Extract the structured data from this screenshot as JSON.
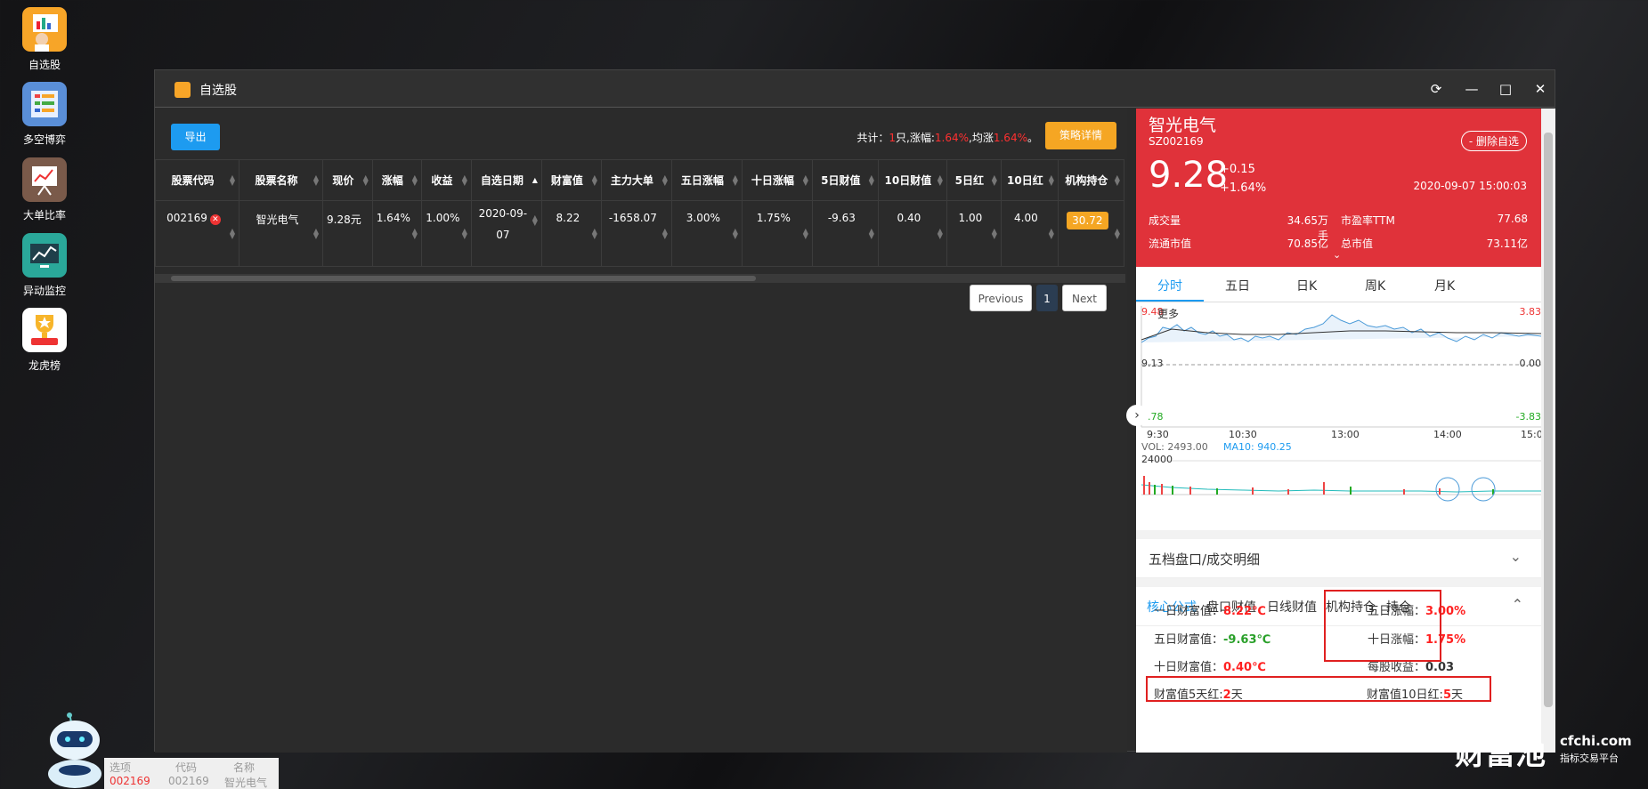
{
  "desktop": {
    "icons": [
      {
        "label": "自选股",
        "icon": "watchlist-icon",
        "color": "#f7a528"
      },
      {
        "label": "多空博弈",
        "icon": "long-short-icon",
        "color": "#5a8fd8"
      },
      {
        "label": "大单比率",
        "icon": "big-order-icon",
        "color": "#7a5a4a"
      },
      {
        "label": "异动监控",
        "icon": "monitor-icon",
        "color": "#2aa89a"
      },
      {
        "label": "龙虎榜",
        "icon": "trophy-icon",
        "color": "#ffffff"
      }
    ]
  },
  "window": {
    "title": "自选股",
    "controls": {
      "refresh": "⟳",
      "minimize": "—",
      "maximize": "□",
      "close": "✕"
    }
  },
  "toolbar": {
    "export_label": "导出",
    "summary": {
      "prefix": "共计：",
      "count": "1",
      "mid1": "只,涨幅:",
      "rise": "1.64%",
      "mid2": ",均涨",
      "avg": "1.64%",
      "suffix": "。"
    },
    "strategy_label": "策略详情"
  },
  "table": {
    "headers": [
      "股票代码",
      "股票名称",
      "现价",
      "涨幅",
      "收益",
      "自选日期",
      "财富值",
      "主力大单",
      "五日涨幅",
      "十日涨幅",
      "5日财值",
      "10日财值",
      "5日红",
      "10日红",
      "机构持仓"
    ],
    "rows": [
      {
        "code": "002169",
        "name": "智光电气",
        "price": "9.28元",
        "change": "1.64%",
        "profit": "1.00%",
        "date_line1": "2020-09-",
        "date_line2": "07",
        "wealth": "8.22",
        "main_big": "-1658.07",
        "five_day_rise": "3.00%",
        "ten_day_rise": "1.75%",
        "five_day_wealth": "-9.63",
        "ten_day_wealth": "0.40",
        "five_day_red": "1.00",
        "ten_day_red": "4.00",
        "institution": "30.72"
      }
    ]
  },
  "pagination": {
    "previous": "Previous",
    "page": "1",
    "next": "Next"
  },
  "quote": {
    "name": "智光电气",
    "code": "SZ002169",
    "remove_label": "- 删除自选",
    "price": "9.28",
    "change": "+0.15",
    "change_pct": "+1.64%",
    "datetime": "2020-09-07 15:00:03",
    "stats": [
      {
        "label": "成交量",
        "value": "34.65万手"
      },
      {
        "label": "市盈率TTM",
        "value": "77.68"
      },
      {
        "label": "流通市值",
        "value": "70.85亿"
      },
      {
        "label": "总市值",
        "value": "73.11亿"
      }
    ]
  },
  "chart_tabs": [
    "分时",
    "五日",
    "日K",
    "周K",
    "月K"
  ],
  "intraday": {
    "more_label": "更多",
    "y_left": [
      "9.48",
      "9.13",
      "8.78"
    ],
    "y_right": [
      "3.83",
      "0.00",
      "-3.83"
    ],
    "x_ticks": [
      "9:30",
      "10:30",
      "13:00",
      "14:00",
      "15:0"
    ],
    "vol_label": "VOL: 2493.00",
    "ma_label": "MA10: 940.25",
    "vol_max": "24000"
  },
  "order_book_label": "五档盘口/成交明细",
  "core_tabs": [
    "核心公式",
    "盘口财值",
    "日线财值",
    "机构持仓",
    "持仓"
  ],
  "indicators": {
    "one_day_wealth": {
      "label": "一日财富值：",
      "value": "8.22℃"
    },
    "five_day_rise": {
      "label": "五日涨幅：",
      "value": "3.00%"
    },
    "five_day_wealth": {
      "label": "五日财富值：",
      "value": "-9.63℃"
    },
    "ten_day_rise": {
      "label": "十日涨幅：",
      "value": "1.75%"
    },
    "ten_day_wealth": {
      "label": "十日财富值：",
      "value": "0.40℃"
    },
    "eps": {
      "label": "每股收益：",
      "value": "0.03"
    },
    "red5": {
      "label": "财富值5天红:",
      "value": "2",
      "unit": "天"
    },
    "red10": {
      "label": "财富值10日红:",
      "value": "5",
      "unit": "天"
    }
  },
  "mini_table": {
    "headers": [
      "选项",
      "代码",
      "名称"
    ],
    "row": [
      "002169",
      "002169",
      "智光电气"
    ]
  },
  "brand": {
    "name": "财富池",
    "site": "cfchi.com",
    "tagline": "指标交易平台"
  }
}
